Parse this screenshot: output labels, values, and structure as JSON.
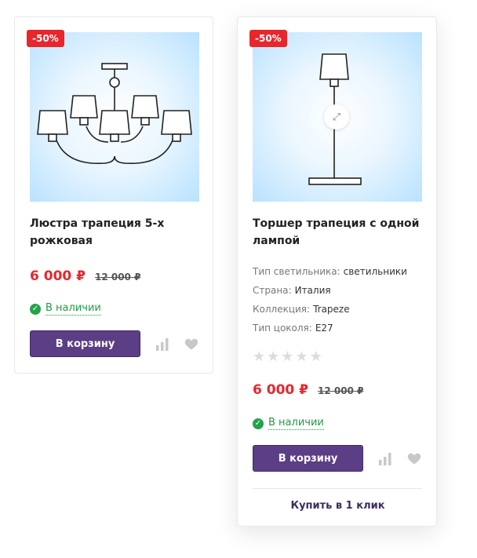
{
  "products": [
    {
      "badge": "-50%",
      "title": "Люстра трапеция 5-х рожковая",
      "price_new": "6 000 ₽",
      "price_old": "12 000 ₽",
      "stock": "В наличии",
      "cart_label": "В корзину"
    },
    {
      "badge": "-50%",
      "title": "Торшер трапеция с одной лампой",
      "props": [
        {
          "label": "Тип светильника:",
          "value": "светильники"
        },
        {
          "label": "Страна:",
          "value": "Италия"
        },
        {
          "label": "Коллекция:",
          "value": "Trapeze"
        },
        {
          "label": "Тип цоколя:",
          "value": "E27"
        }
      ],
      "rating": 0,
      "rating_max": 5,
      "price_new": "6 000 ₽",
      "price_old": "12 000 ₽",
      "stock": "В наличии",
      "cart_label": "В корзину",
      "one_click_label": "Купить в 1 клик"
    }
  ],
  "icons": {
    "stock": "check-circle-icon",
    "compare": "bar-chart-icon",
    "favorite": "heart-icon",
    "zoom": "expand-arrows-icon",
    "rating": "star-icon"
  },
  "colors": {
    "accent": "#5c3e86",
    "price": "#e8262b",
    "badge": "#e8262b",
    "in_stock": "#1f9b45"
  }
}
